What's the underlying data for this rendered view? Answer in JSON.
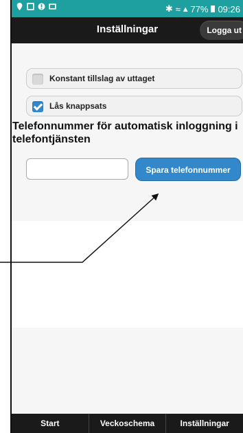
{
  "statusbar": {
    "battery": "77%",
    "time": "09:26"
  },
  "header": {
    "title": "Inställningar",
    "logout_label": "Logga ut"
  },
  "settings": {
    "constant_label": "Konstant tillslag av uttaget",
    "constant_checked": false,
    "lock_label": "Lås knappsats",
    "lock_checked": true,
    "phone_heading": "Telefonnummer för automatisk inloggning i telefontjänsten",
    "phone_value": "",
    "save_label": "Spara telefonnummer"
  },
  "footer": {
    "tabs": [
      "Start",
      "Veckoschema",
      "Inställningar"
    ]
  },
  "colors": {
    "accent": "#3388cc",
    "statusbar": "#1fa0a0",
    "header": "#1a1a1a"
  }
}
